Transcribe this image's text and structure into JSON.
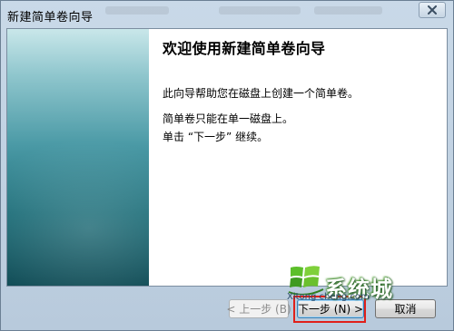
{
  "window": {
    "title": "新建简单卷向导"
  },
  "wizard": {
    "heading": "欢迎使用新建简单卷向导",
    "paragraphs": [
      "此向导帮助您在磁盘上创建一个简单卷。",
      "简单卷只能在单一磁盘上。",
      "单击 “下一步” 继续。"
    ]
  },
  "buttons": {
    "back": "< 上一步 (B)",
    "next": "下一步 (N) >",
    "cancel": "取消"
  },
  "watermark": {
    "brand": "系统城",
    "url": "Xitong cheng.com"
  },
  "colors": {
    "side_panel_top": "#c9e7ea",
    "side_panel_bottom": "#0f4b55",
    "highlight": "#e0201a",
    "logo_green": "#4caf2a"
  },
  "icons": {
    "close": "close-icon",
    "logo": "windows-logo-icon"
  }
}
